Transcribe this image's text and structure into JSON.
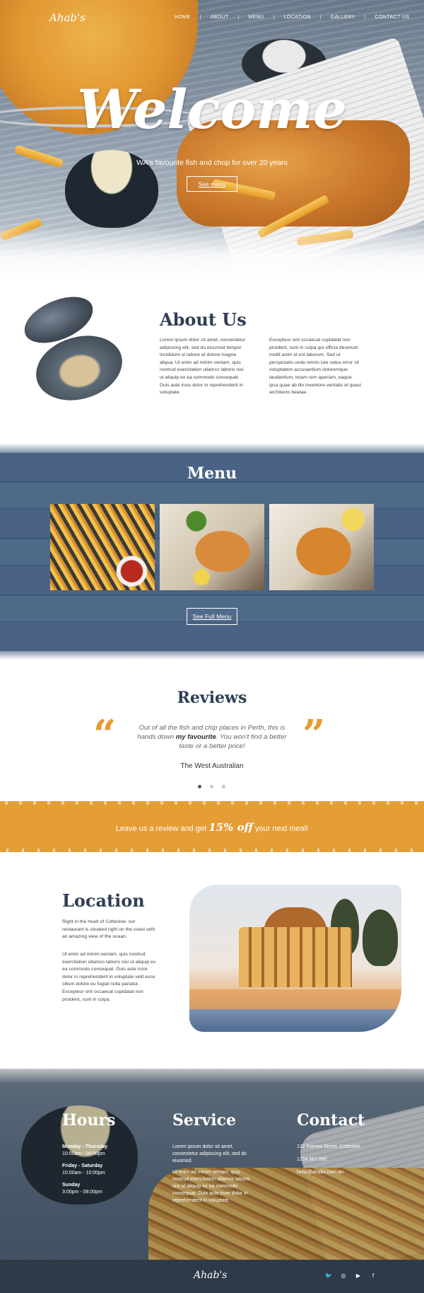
{
  "brand": {
    "name": "Ahab's"
  },
  "nav": {
    "items": [
      "HOME",
      "ABOUT",
      "MENU",
      "LOCATION",
      "GALLERY",
      "CONTACT US"
    ]
  },
  "hero": {
    "title": "Welcome",
    "tagline": "WA's favourite fish and chop for over 20 years",
    "button": "See menu"
  },
  "about": {
    "title": "About Us",
    "col1": "Lorem ipsum dolor sit amet, consectetur adipiscing elit, sed do eiusmod tempor incididunt ut labore et dolore magna aliqua. Ut enim ad minim veniam, quis nostrud exercitation ullamco laboris nisi ut aliquip ex ea commodo consequat. Duis aute irure dolor in reprehenderit in voluptate.",
    "col2": "Excepteur sint occaecat cupidatat non proident, sunt in culpa qui officia deserunt mollit anim id est laborum. Sed ut perspiciatis unde omnis iste natus error sit voluptatem accusantium doloremque laudantium, totam rem aperiam, eaque ipsa quae ab illo inventore veritatis et quasi architecto beatae."
  },
  "menu": {
    "title": "Menu",
    "button": "See Full Menu",
    "photos": [
      "fries-with-sauce-photo",
      "fish-and-chips-plate-photo",
      "battered-fish-photo"
    ]
  },
  "reviews": {
    "title": "Reviews",
    "quote_before": "Out of all the fish and chip places in Perth, this is hands down ",
    "quote_bold": "my favourite",
    "quote_after": ". You won't find a better taste or a better price!",
    "source": "The West Australian",
    "dots": 3,
    "active_dot": 0,
    "open_quote": "“",
    "close_quote": "”"
  },
  "promo": {
    "before": "Leave us a review and get ",
    "highlight": "15% off",
    "after": " your next meal!"
  },
  "location": {
    "title": "Location",
    "para1": "Right in the heart of Cottesloe, our restaurant is situated right on the coast with an amazing view of the ocean.",
    "para2": "Ut enim ad minim veniam, quis nostrud exercitation ullamco laboris nisi ut aliquip ex ea commodo consequat. Duis aute irure dolor in reprehenderit in voluptate velit esse cillum dolore eu fugiat nulla pariatur. Excepteur sint occaecat cupidatat non proident, sunt in culpa."
  },
  "hours": {
    "title": "Hours",
    "rows": [
      {
        "day": "Monday - Thursday",
        "time": "10:00am - 08:00pm"
      },
      {
        "day": "Friday - Saturday",
        "time": "10:00am - 10:00pm"
      },
      {
        "day": "Sunday",
        "time": "3:00pm - 08:00pm"
      }
    ]
  },
  "service": {
    "title": "Service",
    "para1": "Lorem ipsum dolor sit amet, consectetur adipiscing elit, sed do eiusmod.",
    "para2": "Ut enim ad minim veniam, quis nostrud exercitation ullamco laboris nisi ut aliquip ex ea commodo consequat. Duis aute irure dolor in reprehenderit in voluptate."
  },
  "contact": {
    "title": "Contact",
    "address": "132 Forrest Street, Cottesloe",
    "phone": "1234 567 890",
    "email": "hello@ahabs.com.au"
  },
  "footer": {
    "brand": "Ahab's",
    "social": [
      {
        "name": "twitter-icon",
        "glyph": "🐦"
      },
      {
        "name": "instagram-icon",
        "glyph": "◎"
      },
      {
        "name": "youtube-icon",
        "glyph": "▶"
      },
      {
        "name": "facebook-icon",
        "glyph": "f"
      }
    ]
  },
  "colors": {
    "navy": "#2f3e56",
    "accent": "#e59d36",
    "menu_blue": "#4a6384",
    "footer": "#2e3a48"
  }
}
